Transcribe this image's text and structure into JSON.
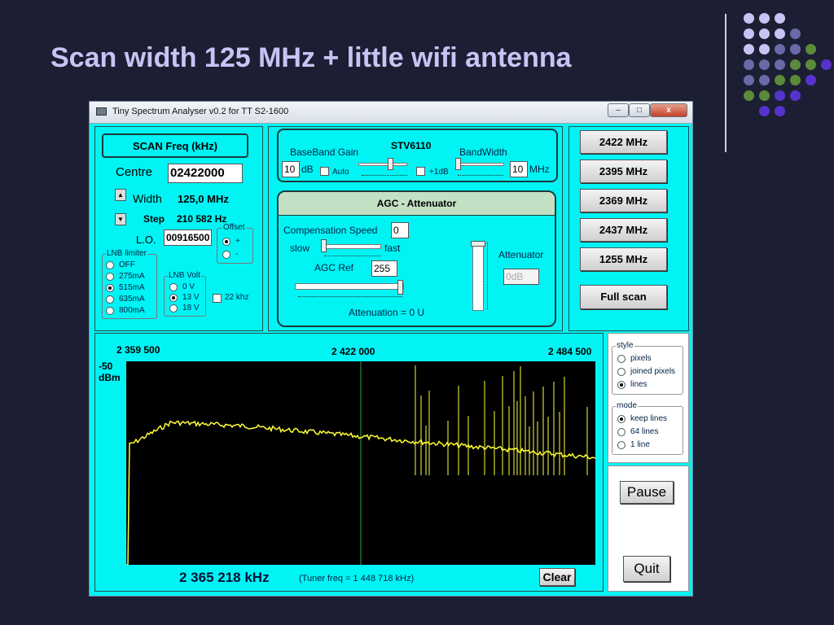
{
  "slide": {
    "title": "Scan width 125 MHz + little wifi antenna"
  },
  "decor": {
    "dot_colors": [
      "#c9c3f5",
      "#6a6aa8",
      "#5b8a3a",
      "#5533cc"
    ]
  },
  "window": {
    "title": "Tiny Spectrum Analyser v0.2 for TT S2-1600",
    "buttons": {
      "minimize": "–",
      "maximize": "□",
      "close": "x"
    }
  },
  "scan": {
    "header": "SCAN Freq (kHz)",
    "centre_label": "Centre",
    "centre_value": "02422000",
    "width_label": "Width",
    "width_value": "125,0 MHz",
    "step_label": "Step",
    "step_value": "210 582 Hz",
    "lo_label": "L.O.",
    "lo_value": "00916500",
    "offset": {
      "title": "Offset",
      "options": [
        "+",
        "-"
      ],
      "selected": 0
    },
    "lnb_limiter": {
      "title": "LNB limiter",
      "options": [
        "OFF",
        "275mA",
        "515mA",
        "635mA",
        "800mA"
      ],
      "selected": 2
    },
    "lnb_volt": {
      "title": "LNB Volt",
      "options": [
        "0 V",
        "13 V",
        "18 V"
      ],
      "selected": 1
    },
    "khz22": "22 khz"
  },
  "stv": {
    "title": "STV6110",
    "baseband_label": "BaseBand Gain",
    "baseband_value": "10",
    "db": "dB",
    "auto": "Auto",
    "plus1db": "+1dB",
    "bandwidth_label": "BandWidth",
    "bandwidth_value": "10",
    "mhz": "MHz"
  },
  "agc": {
    "title": "AGC - Attenuator",
    "comp_speed_label": "Compensation Speed",
    "comp_speed_value": "0",
    "slow": "slow",
    "fast": "fast",
    "agc_ref_label": "AGC Ref",
    "agc_ref_value": "255",
    "attenuator_label": "Attenuator",
    "attenuator_value": "0dB",
    "attenuation": "Attenuation =  0 U"
  },
  "presets": [
    "2422 MHz",
    "2395 MHz",
    "2369 MHz",
    "2437 MHz",
    "1255 MHz"
  ],
  "full_scan": "Full scan",
  "spectrum": {
    "freq_left": "2 359 500",
    "freq_center": "2 422 000",
    "freq_right": "2 484 500",
    "y_label_top": "-50",
    "y_label_unit": "dBm",
    "readout": "2 365 218 kHz",
    "tuner": "(Tuner freq =      1 448 718 kHz)",
    "clear": "Clear",
    "trace_color": "#ffff33",
    "marker_color": "#22aa44"
  },
  "style": {
    "title": "style",
    "options": [
      "pixels",
      "joined pixels",
      "lines"
    ],
    "selected": 2
  },
  "mode": {
    "title": "mode",
    "options": [
      "keep lines",
      "64 lines",
      "1 line"
    ],
    "selected": 0
  },
  "pause": "Pause",
  "quit": "Quit"
}
